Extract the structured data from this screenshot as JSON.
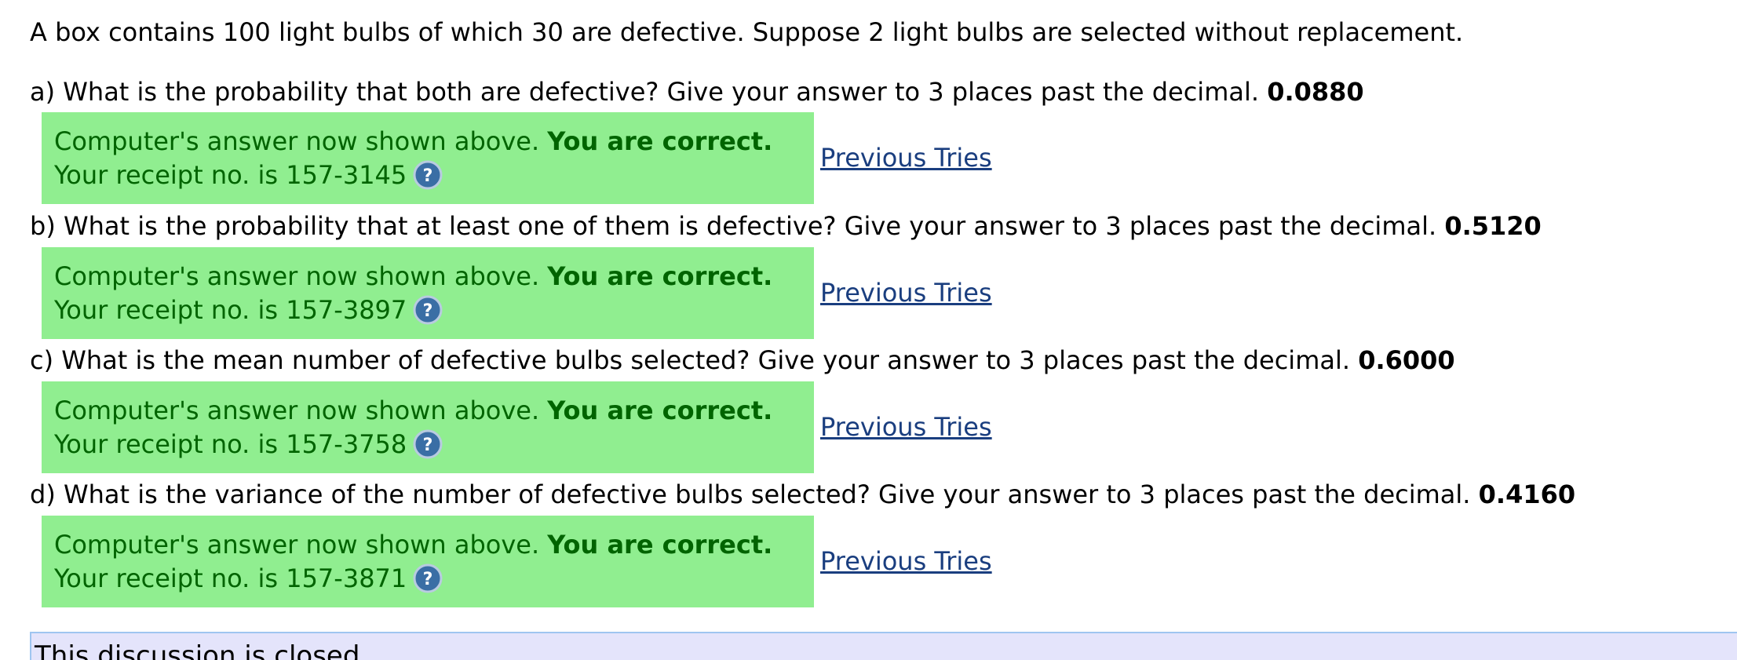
{
  "intro": "A box contains 100 light bulbs of which 30 are defective. Suppose 2 light bulbs are selected without replacement.",
  "questions": [
    {
      "prompt": "a) What is the probability that both are defective? Give your answer to 3 places past the decimal.",
      "answer": "0.0880",
      "feedback_prefix": "Computer's answer now shown above.",
      "feedback_status": "You are correct.",
      "receipt": "Your receipt no. is 157-3145",
      "previous_tries": "Previous Tries"
    },
    {
      "prompt": "b) What is the probability that at least one of them is defective? Give your answer to 3 places past the decimal.",
      "answer": "0.5120",
      "feedback_prefix": "Computer's answer now shown above.",
      "feedback_status": "You are correct.",
      "receipt": "Your receipt no. is 157-3897",
      "previous_tries": "Previous Tries"
    },
    {
      "prompt": "c) What is the mean number of defective bulbs selected? Give your answer to 3 places past the decimal.",
      "answer": "0.6000",
      "feedback_prefix": "Computer's answer now shown above.",
      "feedback_status": "You are correct.",
      "receipt": "Your receipt no. is 157-3758",
      "previous_tries": "Previous Tries"
    },
    {
      "prompt": "d) What is the variance of the number of defective bulbs selected? Give your answer to 3 places past the decimal.",
      "answer": "0.4160",
      "feedback_prefix": "Computer's answer now shown above.",
      "feedback_status": "You are correct.",
      "receipt": "Your receipt no. is 157-3871",
      "previous_tries": "Previous Tries"
    }
  ],
  "discussion": "This discussion is closed.",
  "colors": {
    "feedback_bg": "#90ee90",
    "feedback_text": "#006400",
    "link": "#1a3e7f",
    "help_icon": "#3a6ea5",
    "discussion_bg": "#e4e4fb"
  },
  "icons": {
    "help": "question-help-icon"
  }
}
